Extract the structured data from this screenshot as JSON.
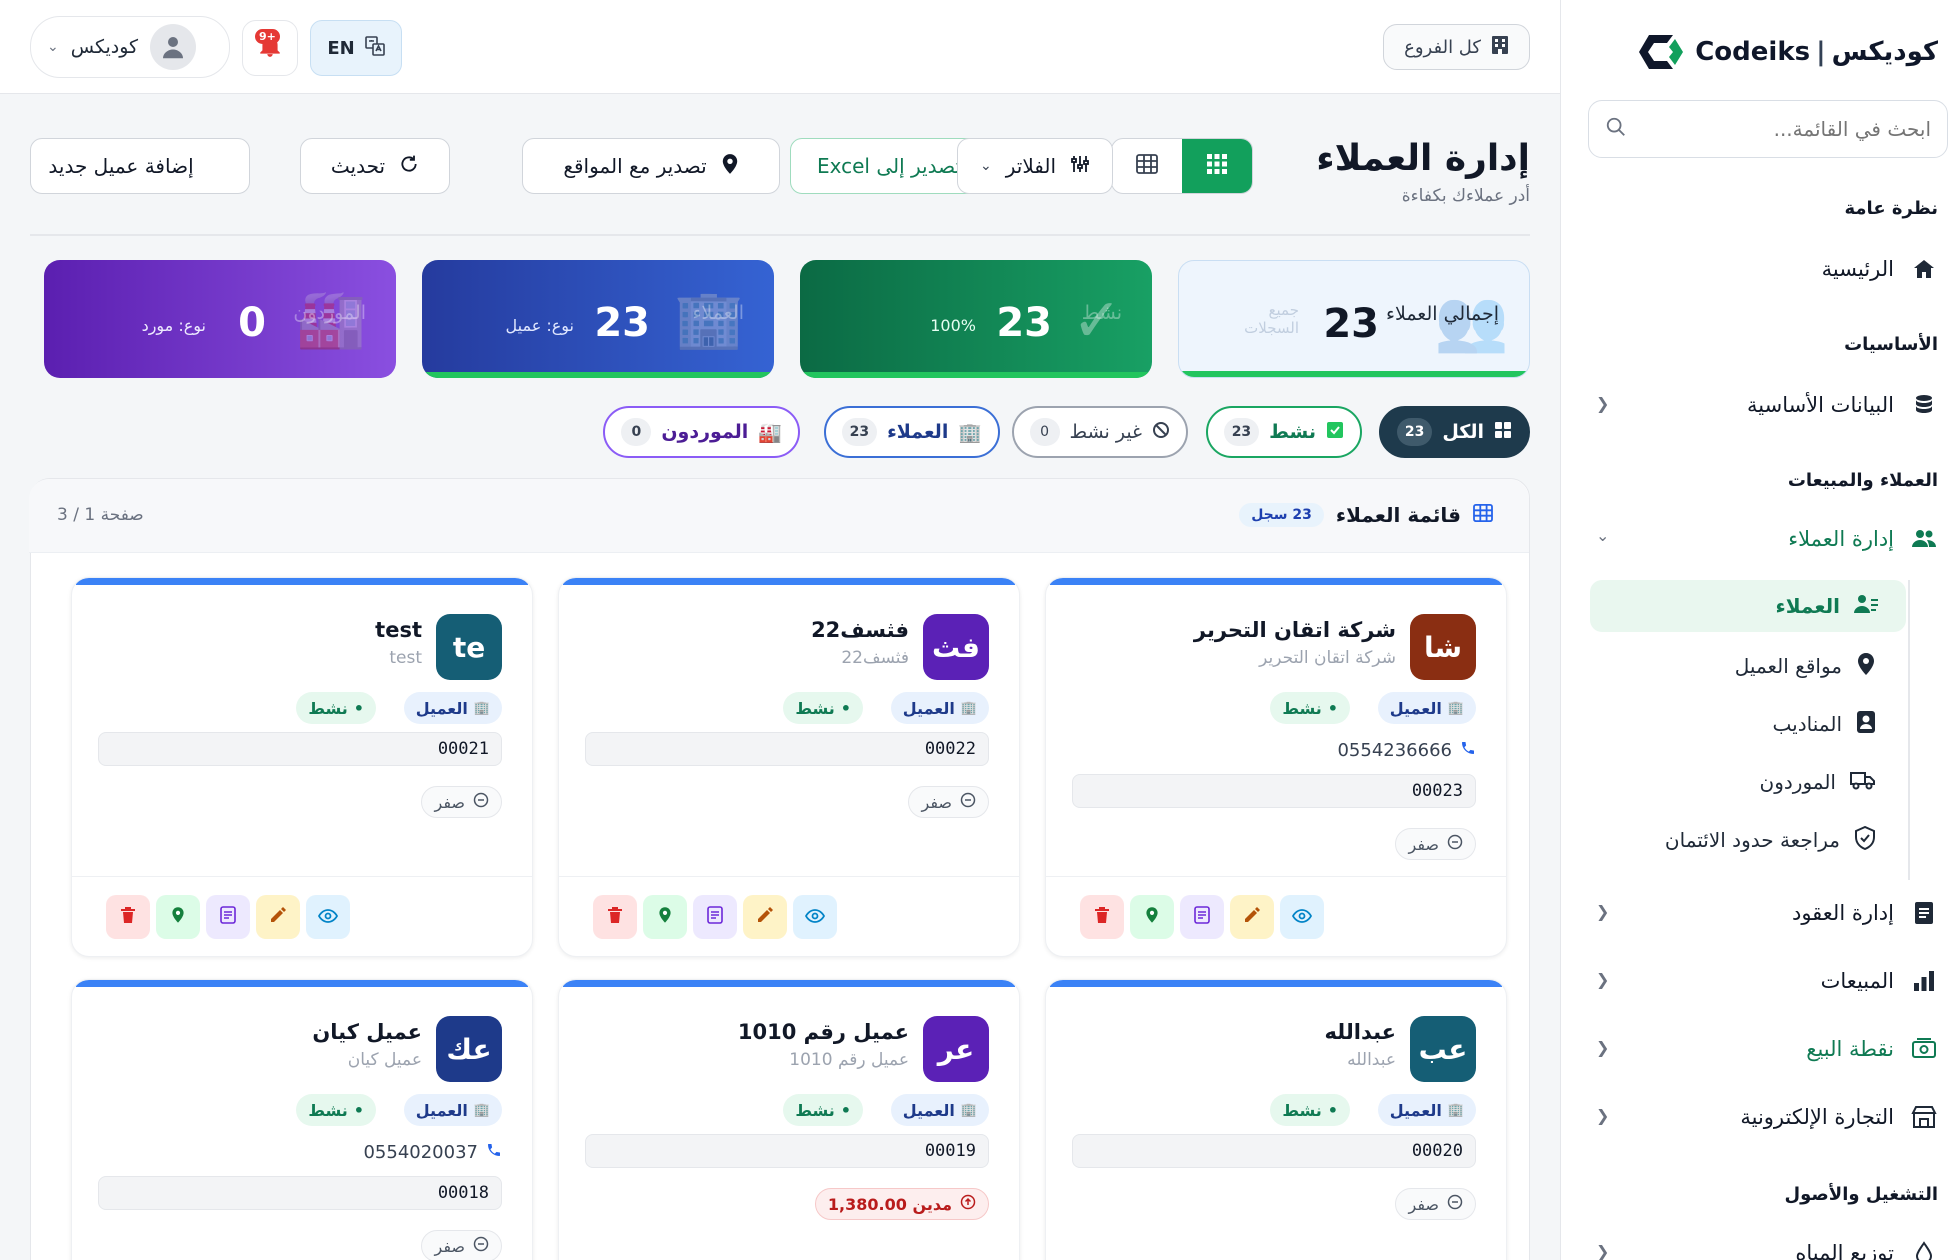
{
  "brand": {
    "name_ar": "كوديكس",
    "name_en": "Codeiks"
  },
  "sidebar": {
    "search_placeholder": "ابحث في القائمة...",
    "sections": {
      "overview": "نظرة عامة",
      "basics": "الأساسيات",
      "customers_sales": "العملاء والمبيعات",
      "operations": "التشغيل والأصول"
    },
    "items": {
      "home": "الرئيسية",
      "master_data": "البيانات الأساسية",
      "customer_mgmt": "إدارة العملاء",
      "contracts": "إدارة العقود",
      "sales": "المبيعات",
      "pos": "نقطة البيع",
      "ecommerce": "التجارة الإلكترونية",
      "water_distribution": "توزيع المياه"
    },
    "subitems": {
      "customers": "العملاء",
      "customer_locations": "مواقع العميل",
      "reps": "المناديب",
      "suppliers": "الموردون",
      "credit_review": "مراجعة حدود الائتمان"
    }
  },
  "topbar": {
    "branches": "كل الفروع",
    "lang": "EN",
    "notif_count": "+9",
    "user": "كوديكس"
  },
  "page": {
    "title": "إدارة العملاء",
    "subtitle": "أدر عملاءك بكفاءة"
  },
  "toolbar": {
    "filters": "الفلاتر",
    "export_excel": "تصدير إلى Excel",
    "export_locations": "تصدير مع المواقع",
    "refresh": "تحديث",
    "add": "إضافة عميل جديد"
  },
  "stats": [
    {
      "label": "إجمالي العملاء",
      "value": "23",
      "ghost": "جميع السجلات",
      "color": "#eef5fd"
    },
    {
      "label": "نشط",
      "value": "23",
      "meta": "100%",
      "color": "#0f7a53"
    },
    {
      "label": "العملاء",
      "value": "23",
      "meta": "نوع: عميل",
      "color": "#2947a8"
    },
    {
      "label": "الموردون",
      "value": "0",
      "meta": "نوع: مورد",
      "color": "#6d28c9"
    }
  ],
  "chips": {
    "all": {
      "label": "الكل",
      "count": "23"
    },
    "active": {
      "label": "نشط",
      "count": "23"
    },
    "inactive": {
      "label": "غير نشط",
      "count": "0"
    },
    "customers": {
      "label": "العملاء",
      "count": "23"
    },
    "suppliers": {
      "label": "الموردون",
      "count": "0"
    }
  },
  "list": {
    "title": "قائمة العملاء",
    "records": "23 سجل",
    "page_info": "صفحة 1 / 3"
  },
  "cards": [
    {
      "initials": "شا",
      "name": "شركة اتقان التحرير",
      "sub": "شركة اتقان التحرير",
      "type": "العميل",
      "status": "نشط",
      "phone": "0554236666",
      "code": "00023",
      "balance": "صفر",
      "avatar_color": "#8a2e12"
    },
    {
      "initials": "فث",
      "name": "فثسف22",
      "sub": "فثسف22",
      "type": "العميل",
      "status": "نشط",
      "phone": "",
      "code": "00022",
      "balance": "صفر",
      "avatar_color": "#5b21b6"
    },
    {
      "initials": "te",
      "name": "test",
      "sub": "test",
      "type": "العميل",
      "status": "نشط",
      "phone": "",
      "code": "00021",
      "balance": "صفر",
      "avatar_color": "#155e75"
    },
    {
      "initials": "عب",
      "name": "عبدالله",
      "sub": "عبدالله",
      "type": "العميل",
      "status": "نشط",
      "phone": "",
      "code": "00020",
      "balance": "صفر",
      "avatar_color": "#155e75"
    },
    {
      "initials": "عر",
      "name": "عميل رقم 1010",
      "sub": "عميل رقم 1010",
      "type": "العميل",
      "status": "نشط",
      "phone": "",
      "code": "00019",
      "balance": "مدين 1,380.00",
      "avatar_color": "#5b21b6"
    },
    {
      "initials": "عك",
      "name": "عميل كيان",
      "sub": "عميل كيان",
      "type": "العميل",
      "status": "نشط",
      "phone": "0554020037",
      "code": "00018",
      "balance": "صفر",
      "avatar_color": "#1e3a8a"
    }
  ],
  "card_actions": [
    "eye-icon",
    "edit-icon",
    "notes-icon",
    "map-pin-icon",
    "trash-icon"
  ]
}
